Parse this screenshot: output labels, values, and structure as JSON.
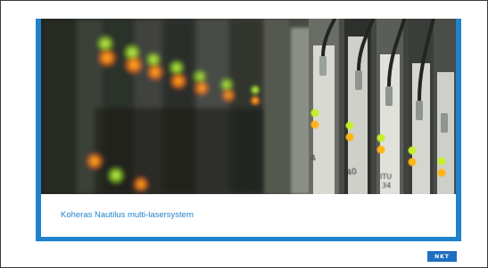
{
  "caption": "Koheras Nautilus multi-lasersystem",
  "logo_text": "NKT",
  "colors": {
    "frame": "#1f82cc",
    "logo_bg": "#1f6fc0"
  }
}
